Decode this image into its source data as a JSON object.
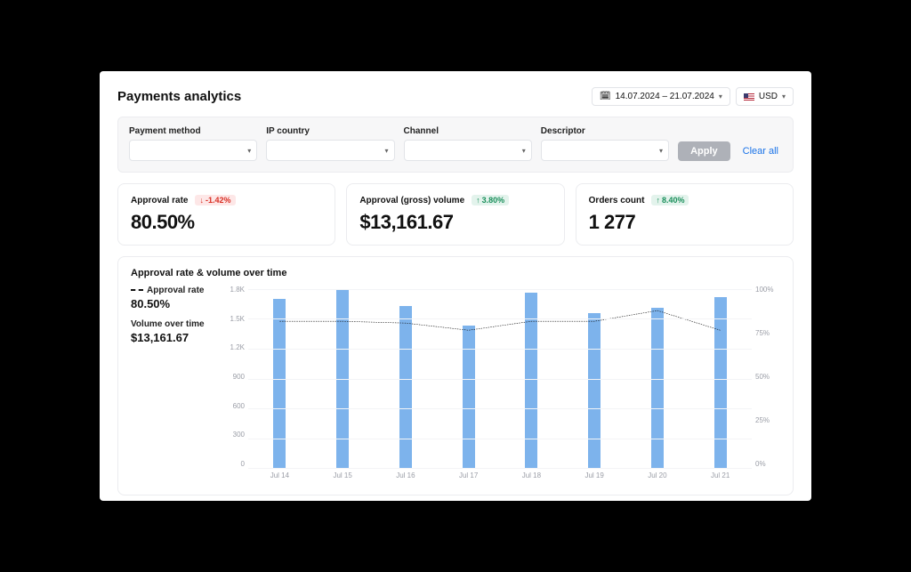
{
  "header": {
    "title": "Payments analytics",
    "date_range": "14.07.2024 – 21.07.2024",
    "currency": "USD"
  },
  "filters": {
    "payment_method_label": "Payment method",
    "ip_country_label": "IP country",
    "channel_label": "Channel",
    "descriptor_label": "Descriptor",
    "apply_label": "Apply",
    "clear_label": "Clear all"
  },
  "stats": {
    "approval_rate": {
      "label": "Approval rate",
      "delta": "-1.42%",
      "direction": "down",
      "value": "80.50%"
    },
    "volume": {
      "label": "Approval (gross) volume",
      "delta": "3.80%",
      "direction": "up",
      "value": "$13,161.67"
    },
    "orders": {
      "label": "Orders count",
      "delta": "8.40%",
      "direction": "up",
      "value": "1 277"
    }
  },
  "chart": {
    "title": "Approval rate & volume over time",
    "legend_rate_label": "Approval rate",
    "legend_rate_value": "80.50%",
    "legend_volume_label": "Volume over time",
    "legend_volume_value": "$13,161.67",
    "y_left_ticks": [
      "1.8K",
      "1.5K",
      "1.2K",
      "900",
      "600",
      "300",
      "0"
    ],
    "y_right_ticks": [
      "100%",
      "75%",
      "50%",
      "25%",
      "0%"
    ],
    "x_labels": [
      "Jul 14",
      "Jul 15",
      "Jul 16",
      "Jul 17",
      "Jul 18",
      "Jul 19",
      "Jul 20",
      "Jul 21"
    ]
  },
  "chart_data": {
    "type": "bar+line",
    "title": "Approval rate & volume over time",
    "categories": [
      "Jul 14",
      "Jul 15",
      "Jul 16",
      "Jul 17",
      "Jul 18",
      "Jul 19",
      "Jul 20",
      "Jul 21"
    ],
    "series": [
      {
        "name": "Volume over time",
        "axis": "left",
        "unit": "USD",
        "values": [
          1700,
          1790,
          1630,
          1430,
          1760,
          1560,
          1610,
          1720
        ]
      },
      {
        "name": "Approval rate",
        "axis": "right",
        "unit": "%",
        "values": [
          82,
          82,
          81,
          77,
          82,
          82,
          88,
          77
        ]
      }
    ],
    "y_left": {
      "label": "Volume",
      "range": [
        0,
        1800
      ],
      "ticks": [
        0,
        300,
        600,
        900,
        1200,
        1500,
        1800
      ]
    },
    "y_right": {
      "label": "Approval rate",
      "range": [
        0,
        100
      ],
      "ticks": [
        0,
        25,
        50,
        75,
        100
      ]
    }
  }
}
